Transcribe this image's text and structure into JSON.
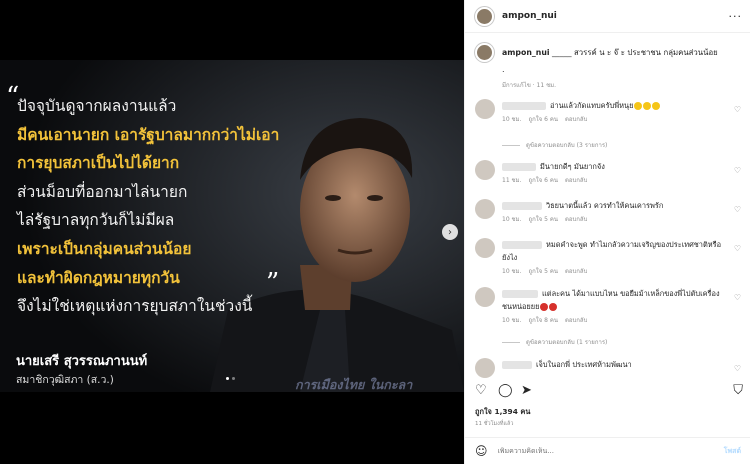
{
  "post": {
    "quote_open": "“",
    "quote_close": "”",
    "quote_lines": [
      {
        "text": "ปัจจุบันดูจากผลงานแล้ว",
        "style": "white"
      },
      {
        "text": "มีคนเอานายก เอารัฐบาลมากกว่าไม่เอา",
        "style": "gold"
      },
      {
        "text": "การยุบสภาเป็นไปได้ยาก",
        "style": "gold"
      },
      {
        "text": "ส่วนม็อบที่ออกมาไล่นายก",
        "style": "white"
      },
      {
        "text": "ไล่รัฐบาลทุกวันก็ไม่มีผล",
        "style": "white"
      },
      {
        "text": "เพราะเป็นกลุ่มคนส่วนน้อย",
        "style": "gold"
      },
      {
        "text": "และทำผิดกฎหมายทุกวัน",
        "style": "gold"
      },
      {
        "text": "จึงไม่ใช่เหตุแห่งการยุบสภาในช่วงนี้",
        "style": "white"
      }
    ],
    "speaker_name": "นายเสรี สุวรรณภานนท์",
    "speaker_role": "สมาชิกวุฒิสภา (ส.ว.)",
    "watermark": "การเมืองไทย ในกะลา",
    "next_icon": "chevron-right-icon",
    "carousel_count": 2
  },
  "header": {
    "username": "ampon_nui",
    "more_icon": "more-horizontal-icon",
    "more_label": "···"
  },
  "caption": {
    "username": "ampon_nui",
    "text": " _____ สวรรค์ น ะ จ๊ ะ ประชาชน กลุ่มคนส่วนน้อย",
    "dot": ".",
    "meta": "มีการแก้ไข · 11 ชม."
  },
  "comments": [
    {
      "text": "อ่านแล้วกัดแทบครับพี่หนุย",
      "emoji": "yellow",
      "emoji_count": 3,
      "time": "10 ชม.",
      "likes": "ถูกใจ 6 คน",
      "reply": "ตอบกลับ",
      "blur_w": 44,
      "replies": "ดูข้อความตอบกลับ (3 รายการ)"
    },
    {
      "text": "มีนายกดีๆ มันยากจัง",
      "time": "11 ชม.",
      "likes": "ถูกใจ 6 คน",
      "reply": "ตอบกลับ",
      "blur_w": 34
    },
    {
      "text": "วิธยนาตนี้แล้ว ควรทำให้คนเคารพรัก",
      "time": "10 ชม.",
      "likes": "ถูกใจ 5 คน",
      "reply": "ตอบกลับ",
      "blur_w": 40
    },
    {
      "text": "หมดคำจะพูด ทำไมกลัวความเจริญของประเทศชาติหรือยังไง",
      "time": "10 ชม.",
      "likes": "ถูกใจ 5 คน",
      "reply": "ตอบกลับ",
      "blur_w": 40
    },
    {
      "text": "แต่ละคน ได้มาแบบไหน ขอยืมม้าเหล็กของพี่ไปตับเครื่องชนหน่อยยย",
      "emoji": "red",
      "emoji_count": 2,
      "time": "10 ชม.",
      "likes": "ถูกใจ 8 คน",
      "reply": "ตอบกลับ",
      "blur_w": 36,
      "replies": "ดูข้อความตอบกลับ (1 รายการ)"
    },
    {
      "text": "เจ็บในอกพี่ ประเทศห้ามพัฒนา",
      "time": "",
      "likes": "",
      "reply": "",
      "blur_w": 30
    }
  ],
  "actions": {
    "like_icon": "heart-icon",
    "comment_icon": "comment-icon",
    "share_icon": "send-icon",
    "save_icon": "bookmark-icon",
    "likes_label": "ถูกใจ 1,394 คน",
    "date": "11 ชั่วโมงที่แล้ว"
  },
  "add_comment": {
    "emoji_icon": "smiley-icon",
    "placeholder": "เพิ่มความคิดเห็น...",
    "post_label": "โพสต์"
  }
}
